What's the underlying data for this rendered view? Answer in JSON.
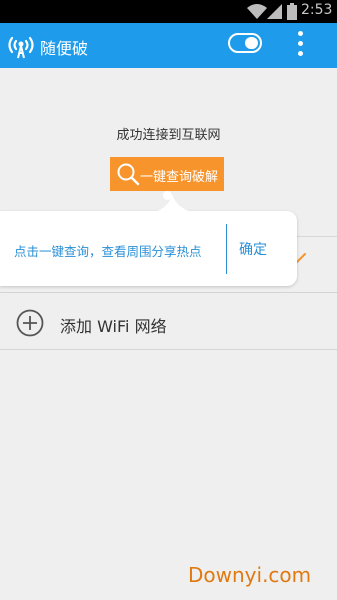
{
  "status_bar": {
    "time": "2:53",
    "icons": [
      "wifi-icon",
      "signal-icon",
      "battery-icon"
    ]
  },
  "app_bar": {
    "title": "随便破",
    "logo_icon": "wifi-crack-logo-icon",
    "toggle_state": "on",
    "menu_icon": "more-vert-icon",
    "color": "#1e9ceb"
  },
  "main": {
    "status_text": "成功连接到互联网",
    "query_button_label": "一键查询破解",
    "query_button_icon": "search-icon",
    "query_button_color": "#f7942c"
  },
  "tooltip": {
    "message": "点击一键查询，查看周围分享热点",
    "confirm_label": "确定",
    "text_color": "#2a8fd6"
  },
  "list": {
    "add_wifi_label": "添加 WiFi 网络",
    "add_icon": "add-circle-icon"
  },
  "watermark": {
    "text": "Downyi.com"
  }
}
